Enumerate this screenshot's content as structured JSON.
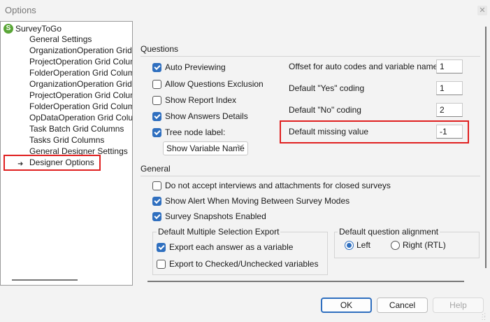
{
  "window": {
    "title": "Options"
  },
  "tree": {
    "root": "SurveyToGo",
    "items": [
      "General Settings",
      "OrganizationOperation Grid Co",
      "ProjectOperation Grid Columns",
      "FolderOperation Grid Columns",
      "OrganizationOperation Grid Co",
      "ProjectOperation Grid Columns",
      "FolderOperation Grid Columns",
      "OpDataOperation Grid Columns",
      "Task Batch Grid Columns",
      "Tasks Grid Columns",
      "General Designer Settings",
      "Designer Options"
    ]
  },
  "questions": {
    "heading": "Questions",
    "auto_previewing": "Auto Previewing",
    "allow_questions_exclusion": "Allow Questions Exclusion",
    "show_report_index": "Show Report Index",
    "show_answers_details": "Show Answers Details",
    "tree_node_label": "Tree node label:",
    "tree_node_select": "Show Variable Name",
    "offset_label": "Offset for auto codes and variable names:",
    "offset_value": "1",
    "yes_label": "Default \"Yes\" coding",
    "yes_value": "1",
    "no_label": "Default \"No\" coding",
    "no_value": "2",
    "missing_label": "Default missing value",
    "missing_value": "-1"
  },
  "general": {
    "heading": "General",
    "no_accept_closed": "Do not accept interviews and attachments for closed surveys",
    "show_alert": "Show Alert When Moving Between Survey Modes",
    "snapshots": "Survey Snapshots Enabled",
    "multi_export_title": "Default Multiple Selection Export",
    "export_each": "Export each answer as a variable",
    "export_checked": "Export to Checked/Unchecked variables",
    "alignment_title": "Default question alignment",
    "left": "Left",
    "right": "Right (RTL)"
  },
  "buttons": {
    "ok": "OK",
    "cancel": "Cancel",
    "help": "Help"
  },
  "colors": {
    "accent": "#2f6fbf",
    "highlight_box": "#e02020"
  }
}
